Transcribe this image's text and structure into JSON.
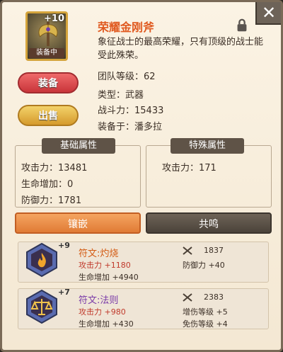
{
  "item": {
    "plus": "+10",
    "equipped_label": "装备中",
    "name": "荣耀金刚斧",
    "description": "象征战士的最高荣耀，只有顶级的战士能受此殊荣。",
    "team_level_label": "团队等级：",
    "team_level": "62",
    "type_label": "类型：",
    "type": "武器",
    "power_label": "战斗力：",
    "power": "15433",
    "equipped_on_label": "装备于：",
    "equipped_on": "潘多拉"
  },
  "buttons": {
    "equip": "装备",
    "sell": "出售"
  },
  "basic": {
    "title": "基础属性",
    "attack": "攻击力：13481",
    "hp": "生命增加：0",
    "defense": "防御力：1781"
  },
  "special": {
    "title": "特殊属性",
    "attack": "攻击力：171"
  },
  "tabs": {
    "inlay": "镶嵌",
    "resonance": "共鸣"
  },
  "runes": [
    {
      "level": "+9",
      "name": "符文:灼烧",
      "power": "1837",
      "stat1": "攻击力 +1180",
      "stat2": "生命增加 +4940",
      "stat3": "防御力 +40",
      "stat4": ""
    },
    {
      "level": "+7",
      "name": "符文:法则",
      "power": "2383",
      "stat1": "攻击力 +980",
      "stat2": "生命增加 +430",
      "stat3": "增伤等级 +5",
      "stat4": "免伤等级 +4"
    }
  ],
  "colors": {
    "title": "#e05a20",
    "accent_red": "#c0392b",
    "rune1_name": "#d35a12",
    "rune2_name": "#7a3aa8"
  }
}
